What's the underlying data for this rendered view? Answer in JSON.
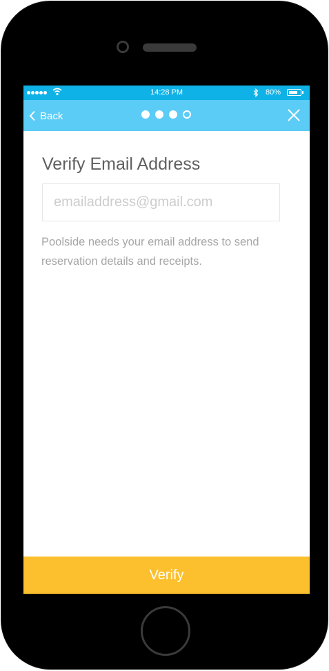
{
  "status_bar": {
    "time": "14:28 PM",
    "battery": "80%"
  },
  "nav": {
    "back_label": "Back",
    "steps_total": 4,
    "steps_completed": 3
  },
  "main": {
    "title": "Verify Email Address",
    "email_placeholder": "emailaddress@gmail.com",
    "email_value": "",
    "helper_text": "Poolside needs your email address to send reservation details and receipts."
  },
  "footer": {
    "verify_label": "Verify"
  },
  "colors": {
    "status_bar": "#0fb2e6",
    "nav_bar": "#5bccf6",
    "verify_button": "#fcc02f",
    "title": "#606060",
    "helper_text": "#a6a6a6"
  }
}
